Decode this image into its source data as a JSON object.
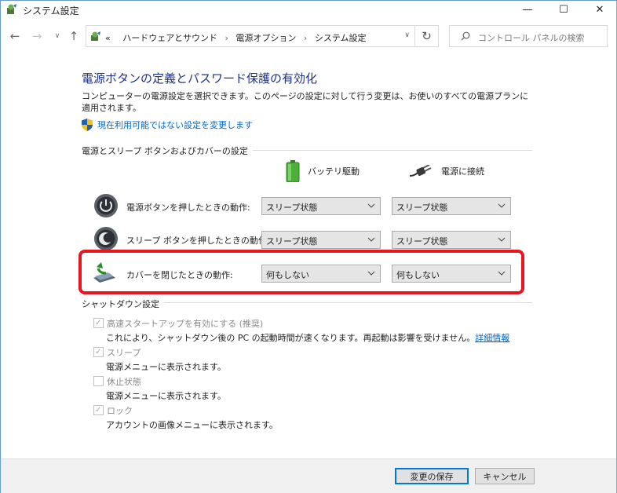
{
  "window": {
    "title": "システム設定",
    "minimize": "—",
    "maximize": "☐",
    "close": "✕"
  },
  "nav": {
    "back": "←",
    "forward": "→",
    "recent": "∨",
    "up": "↑",
    "breadcrumb": [
      "«",
      "ハードウェアとサウンド",
      "電源オプション",
      "システム設定"
    ],
    "separator": "›",
    "refresh": "↻",
    "dropdown": "∨",
    "search_placeholder": "コントロール パネルの検索"
  },
  "page": {
    "heading": "電源ボタンの定義とパスワード保護の有効化",
    "description": "コンピューターの電源設定を選択できます。このページの設定に対して行う変更は、お使いのすべての電源プランに適用されます。",
    "uac_link": "現在利用可能ではない設定を変更します"
  },
  "power_group": {
    "label": "電源とスリープ ボタンおよびカバーの設定",
    "col_battery": "バッテリ駆動",
    "col_plugged": "電源に接続",
    "rows": [
      {
        "label": "電源ボタンを押したときの動作:",
        "battery": "スリープ状態",
        "plugged": "スリープ状態",
        "icon": "power-button-icon"
      },
      {
        "label": "スリープ ボタンを押したときの動作:",
        "battery": "スリープ状態",
        "plugged": "スリープ状態",
        "icon": "sleep-button-icon"
      },
      {
        "label": "カバーを閉じたときの動作:",
        "battery": "何もしない",
        "plugged": "何もしない",
        "icon": "laptop-lid-icon"
      }
    ]
  },
  "shutdown_group": {
    "label": "シャットダウン設定",
    "items": [
      {
        "title": "高速スタートアップを有効にする (推奨)",
        "checked": true,
        "desc": "これにより、シャットダウン後の PC の起動時間が速くなります。再起動は影響を受けません。",
        "link": "詳細情報"
      },
      {
        "title": "スリープ",
        "checked": true,
        "desc": "電源メニューに表示されます。"
      },
      {
        "title": "休止状態",
        "checked": false,
        "desc": "電源メニューに表示されます。"
      },
      {
        "title": "ロック",
        "checked": true,
        "desc": "アカウントの画像メニューに表示されます。"
      }
    ]
  },
  "footer": {
    "save": "変更の保存",
    "cancel": "キャンセル"
  },
  "colors": {
    "heading": "#1e3287",
    "link": "#0066cc",
    "highlight": "#e8141e"
  }
}
